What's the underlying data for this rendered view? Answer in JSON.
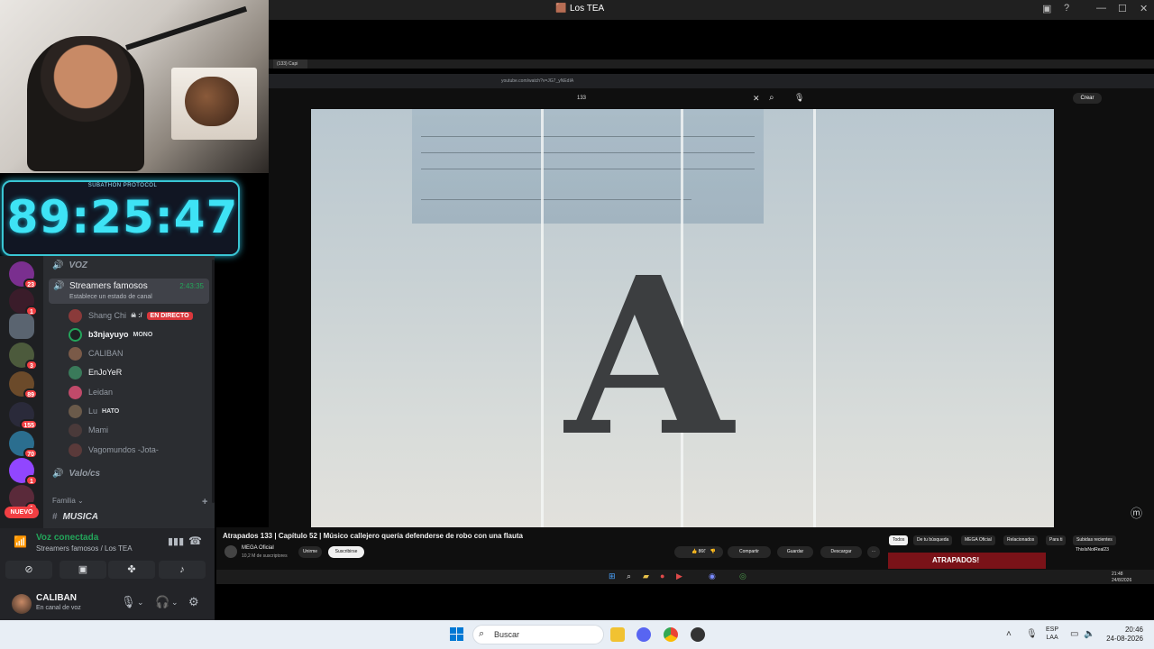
{
  "window": {
    "title": "Los TEA"
  },
  "timer": {
    "label": "SUBATHON PROTOCOL",
    "value": "89:25:47"
  },
  "server_rail": {
    "badges": [
      "23",
      "1",
      "",
      "3",
      "89",
      "155",
      "70",
      "1",
      "1"
    ],
    "new_label": "NUEVO"
  },
  "channels": {
    "voice_category": "VOZ",
    "active_channel": {
      "name": "Streamers famosos",
      "status": "Establece un estado de canal",
      "duration": "2:43:35"
    },
    "members": [
      {
        "name": "Shang Chi",
        "tag": "☠ :/",
        "live": "EN DIRECTO"
      },
      {
        "name": "b3njayuyo",
        "tag": "MONO",
        "live": ""
      },
      {
        "name": "CALIBAN",
        "tag": "",
        "live": ""
      },
      {
        "name": "EnJoYeR",
        "tag": "",
        "live": ""
      },
      {
        "name": "Leidan",
        "tag": "",
        "live": ""
      },
      {
        "name": "Lu",
        "tag": "HATO",
        "live": ""
      },
      {
        "name": "Mami",
        "tag": "",
        "live": ""
      },
      {
        "name": "Vagomundos -Jota-",
        "tag": "",
        "live": ""
      }
    ],
    "channel_valo": "Valo/cs",
    "category_familia": "Familia",
    "channel_musica": "MUSICA"
  },
  "voice_panel": {
    "status": "Voz conectada",
    "location": "Streamers famosos / Los TEA"
  },
  "user_panel": {
    "name": "CALIBAN",
    "status": "En canal de voz"
  },
  "browser": {
    "tab_label": "(133) Capi",
    "url": "youtube.com/watch?v=JG7_yNEdIA"
  },
  "youtube": {
    "search_value": "133",
    "create_label": "Crear",
    "video_title": "Atrapados 133  |  Capítulo 52 | Músico callejero quería defenderse de robo con una flauta",
    "channel": "MEGA Oficial",
    "subscribers": "10,2 M de suscriptores",
    "join_label": "Unirme",
    "subscribe_label": "Suscribirse",
    "likes": "866",
    "share_label": "Compartir",
    "save_label": "Guardar",
    "download_label": "Descargar",
    "chips": [
      "Todos",
      "De tu búsqueda",
      "MEGA Oficial",
      "Relacionados",
      "Para ti",
      "Subidas recientes"
    ],
    "promo_title": "ATRAPADOS!",
    "video_letter": "A",
    "rec_channel": "ThisIsNotReal23"
  },
  "inner_taskbar": {
    "time": "21:48",
    "date": "24/8/2026"
  },
  "taskbar": {
    "search_placeholder": "Buscar",
    "lang_1": "ESP",
    "lang_2": "LAA",
    "time": "20:46",
    "date": "24-08-2026"
  }
}
